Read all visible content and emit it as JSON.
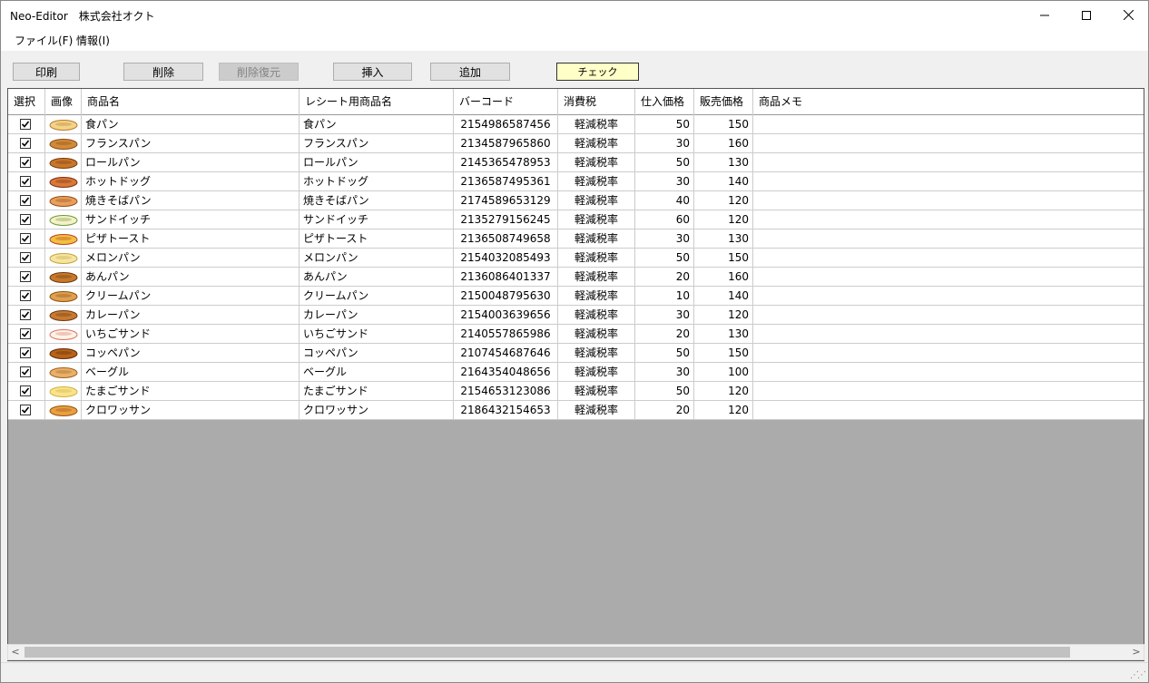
{
  "window": {
    "title": "Neo-Editor　株式会社オクト",
    "minimize_glyph": "—",
    "maximize_glyph": "☐",
    "close_glyph": "✕"
  },
  "menu": {
    "file": "ファイル(F)",
    "info": "情報(I)"
  },
  "toolbar": {
    "print": "印刷",
    "delete": "削除",
    "undo_delete": "削除復元",
    "insert": "挿入",
    "add": "追加",
    "check": "チェック"
  },
  "grid": {
    "headers": [
      "選択",
      "画像",
      "商品名",
      "レシート用商品名",
      "バーコード",
      "消費税",
      "仕入価格",
      "販売価格",
      "商品メモ"
    ],
    "rows": [
      {
        "checked": true,
        "image": "bread-loaf",
        "name": "食パン",
        "receipt_name": "食パン",
        "barcode": "2154986587456",
        "tax": "軽減税率",
        "cost": "50",
        "price": "150",
        "memo": ""
      },
      {
        "checked": true,
        "image": "baguette",
        "name": "フランスパン",
        "receipt_name": "フランスパン",
        "barcode": "2134587965860",
        "tax": "軽減税率",
        "cost": "30",
        "price": "160",
        "memo": ""
      },
      {
        "checked": true,
        "image": "roll",
        "name": "ロールパン",
        "receipt_name": "ロールパン",
        "barcode": "2145365478953",
        "tax": "軽減税率",
        "cost": "50",
        "price": "130",
        "memo": ""
      },
      {
        "checked": true,
        "image": "hotdog",
        "name": "ホットドッグ",
        "receipt_name": "ホットドッグ",
        "barcode": "2136587495361",
        "tax": "軽減税率",
        "cost": "30",
        "price": "140",
        "memo": ""
      },
      {
        "checked": true,
        "image": "yakisoba-bun",
        "name": "焼きそばパン",
        "receipt_name": "焼きそばパン",
        "barcode": "2174589653129",
        "tax": "軽減税率",
        "cost": "40",
        "price": "120",
        "memo": ""
      },
      {
        "checked": true,
        "image": "sandwich",
        "name": "サンドイッチ",
        "receipt_name": "サンドイッチ",
        "barcode": "2135279156245",
        "tax": "軽減税率",
        "cost": "60",
        "price": "120",
        "memo": ""
      },
      {
        "checked": true,
        "image": "pizza-toast",
        "name": "ピザトースト",
        "receipt_name": "ピザトースト",
        "barcode": "2136508749658",
        "tax": "軽減税率",
        "cost": "30",
        "price": "130",
        "memo": ""
      },
      {
        "checked": true,
        "image": "melon-bun",
        "name": "メロンパン",
        "receipt_name": "メロンパン",
        "barcode": "2154032085493",
        "tax": "軽減税率",
        "cost": "50",
        "price": "150",
        "memo": ""
      },
      {
        "checked": true,
        "image": "anpan",
        "name": "あんパン",
        "receipt_name": "あんパン",
        "barcode": "2136086401337",
        "tax": "軽減税率",
        "cost": "20",
        "price": "160",
        "memo": ""
      },
      {
        "checked": true,
        "image": "cream-bun",
        "name": "クリームパン",
        "receipt_name": "クリームパン",
        "barcode": "2150048795630",
        "tax": "軽減税率",
        "cost": "10",
        "price": "140",
        "memo": ""
      },
      {
        "checked": true,
        "image": "curry-bun",
        "name": "カレーパン",
        "receipt_name": "カレーパン",
        "barcode": "2154003639656",
        "tax": "軽減税率",
        "cost": "30",
        "price": "120",
        "memo": ""
      },
      {
        "checked": true,
        "image": "strawberry-sandwich",
        "name": "いちごサンド",
        "receipt_name": "いちごサンド",
        "barcode": "2140557865986",
        "tax": "軽減税率",
        "cost": "20",
        "price": "130",
        "memo": ""
      },
      {
        "checked": true,
        "image": "koppe-bun",
        "name": "コッペパン",
        "receipt_name": "コッペパン",
        "barcode": "2107454687646",
        "tax": "軽減税率",
        "cost": "50",
        "price": "150",
        "memo": ""
      },
      {
        "checked": true,
        "image": "bagel",
        "name": "ベーグル",
        "receipt_name": "ベーグル",
        "barcode": "2164354048656",
        "tax": "軽減税率",
        "cost": "30",
        "price": "100",
        "memo": ""
      },
      {
        "checked": true,
        "image": "egg-sandwich",
        "name": "たまごサンド",
        "receipt_name": "たまごサンド",
        "barcode": "2154653123086",
        "tax": "軽減税率",
        "cost": "50",
        "price": "120",
        "memo": ""
      },
      {
        "checked": true,
        "image": "croissant",
        "name": "クロワッサン",
        "receipt_name": "クロワッサン",
        "barcode": "2186432154653",
        "tax": "軽減税率",
        "cost": "20",
        "price": "120",
        "memo": ""
      }
    ]
  },
  "scroll": {
    "left_glyph": "<",
    "right_glyph": ">"
  },
  "status": {
    "grip_glyph": "⋰⋰"
  }
}
